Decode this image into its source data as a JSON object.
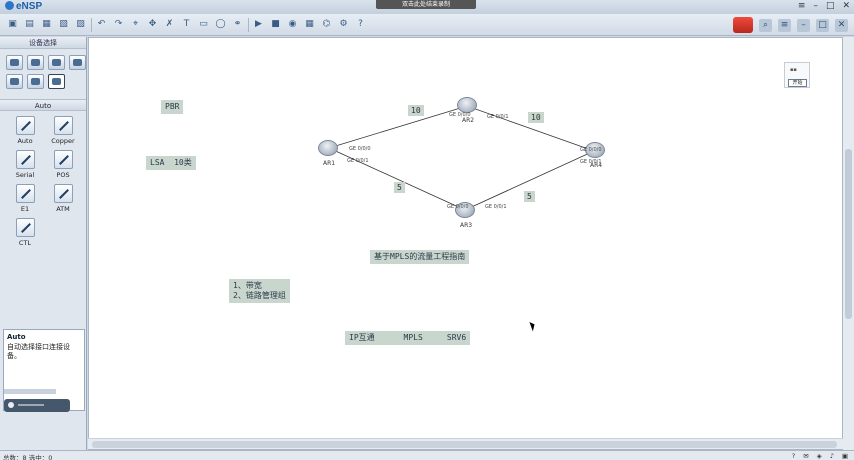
{
  "app": {
    "title": "eNSP",
    "recording_banner": "双击此处结束录制"
  },
  "toolbar": {
    "icons": [
      "new-icon",
      "open-icon",
      "save-icon",
      "save-as-icon",
      "print-icon",
      "undo-icon",
      "redo-icon",
      "select-icon",
      "move-icon",
      "delete-icon",
      "text-icon",
      "rect-icon",
      "ellipse-icon",
      "link-icon",
      "start-icon",
      "stop-icon",
      "capture-icon",
      "grid-icon",
      "topology-icon",
      "settings-icon",
      "help-icon"
    ]
  },
  "left_panel": {
    "devices_title": "设备选择",
    "cables_title": "Auto",
    "cables": [
      {
        "label": "Auto"
      },
      {
        "label": "Copper"
      },
      {
        "label": "Serial"
      },
      {
        "label": "POS"
      },
      {
        "label": "E1"
      },
      {
        "label": "ATM"
      },
      {
        "label": "CTL"
      }
    ],
    "info_title": "Auto",
    "info_text": "自动选择接口连接设备。"
  },
  "canvas": {
    "pbr": "PBR",
    "lsa": "LSA  10类",
    "mpls_title": "基于MPLS的流量工程指南",
    "list": "1、带宽\n2、链路管理组",
    "bottom": "IP互通      MPLS     SRV6",
    "costs": [
      "10",
      "10",
      "5",
      "5"
    ],
    "nodes": [
      "AR1",
      "AR2",
      "AR3",
      "AR4"
    ],
    "ports": [
      "GE 0/0/0",
      "GE 0/0/1",
      "GE 0/0/0",
      "GE 0/0/1",
      "GE 0/0/0",
      "GE 0/0/1",
      "GE 0/0/0",
      "GE 0/0/1"
    ],
    "start_label": "开始"
  },
  "status": {
    "left": "总数：8  选中：0",
    "right_icons": [
      "help-icon",
      "message-icon",
      "notify-icon",
      "sound-icon",
      "extra-icon"
    ]
  }
}
